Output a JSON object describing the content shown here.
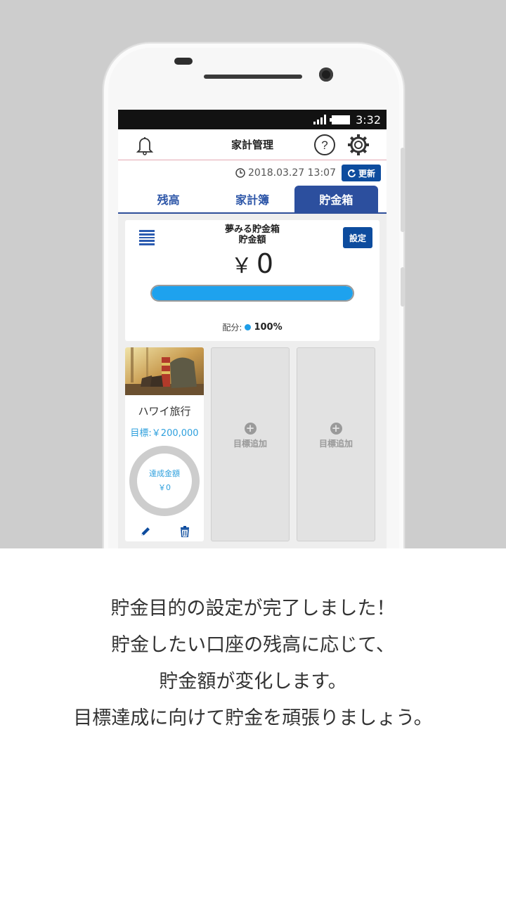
{
  "status": {
    "time": "3:32"
  },
  "app": {
    "title": "家計管理",
    "updated_at": "2018.03.27 13:07",
    "refresh_label": "更新"
  },
  "tabs": [
    {
      "label": "残高",
      "active": false
    },
    {
      "label": "家計簿",
      "active": false
    },
    {
      "label": "貯金箱",
      "active": true
    }
  ],
  "savings": {
    "name": "夢みる貯金箱",
    "amount_label": "貯金額",
    "settings_label": "設定",
    "currency": "￥",
    "amount": "0",
    "progress_fraction": 1.0,
    "distribution_label": "配分:",
    "distribution_value": "100%",
    "distribution_color": "#1e9ee8"
  },
  "goals": [
    {
      "title": "ハワイ旅行",
      "target": "目標:￥200,000",
      "achieved_label": "達成金額",
      "achieved_amount": "￥0"
    }
  ],
  "add_goal_label": "目標追加",
  "caption": [
    "貯金目的の設定が完了しました！",
    "貯金したい口座の残高に応じて、",
    "貯金額が変化します。",
    "目標達成に向けて貯金を頑張りましょう。"
  ],
  "colors": {
    "accent": "#0d4c9e",
    "tab_active": "#2c4f9e",
    "progress": "#1ea2ee",
    "target_text": "#2fa0dd"
  }
}
